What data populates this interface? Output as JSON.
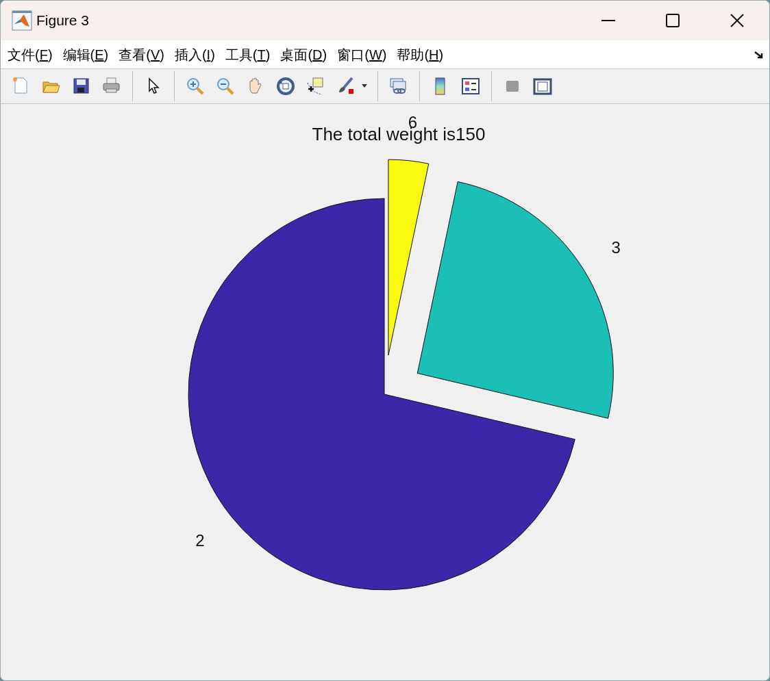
{
  "window": {
    "title": "Figure 3"
  },
  "menu": [
    {
      "label": "文件(F)"
    },
    {
      "label": "编辑(E)"
    },
    {
      "label": "查看(V)"
    },
    {
      "label": "插入(I)"
    },
    {
      "label": "工具(T)"
    },
    {
      "label": "桌面(D)"
    },
    {
      "label": "窗口(W)"
    },
    {
      "label": "帮助(H)"
    }
  ],
  "figure": {
    "chart_data": {
      "type": "pie",
      "title": "The total weight is150",
      "categories": [
        "2",
        "3",
        "6"
      ],
      "values": [
        71.3,
        25.4,
        3.3
      ]
    },
    "slices": [
      {
        "color": "#3e26a8",
        "exploded": false
      },
      {
        "color": "#1bbfb5",
        "exploded": true
      },
      {
        "color": "#f9fa0f",
        "exploded": true
      }
    ]
  }
}
